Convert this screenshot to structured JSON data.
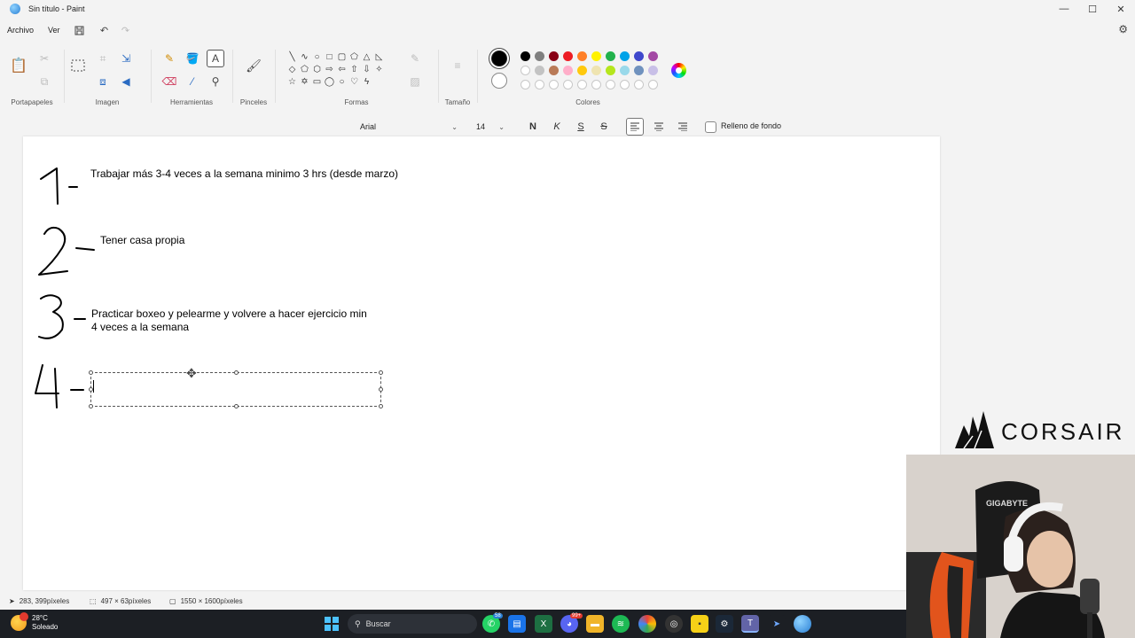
{
  "window": {
    "title": "Sin título - Paint",
    "minimize": "—",
    "maximize": "☐",
    "close": "✕"
  },
  "menu": {
    "file": "Archivo",
    "view": "Ver"
  },
  "ribbon": {
    "groups": {
      "clipboard": "Portapapeles",
      "image": "Imagen",
      "tools": "Herramientas",
      "brushes": "Pinceles",
      "shapes": "Formas",
      "size": "Tamaño",
      "colors": "Colores"
    },
    "primary_color": "#000000",
    "secondary_color": "#ffffff",
    "palette_row1": [
      "#000000",
      "#7f7f7f",
      "#880015",
      "#ed1c24",
      "#ff7f27",
      "#fff200",
      "#22b14c",
      "#00a2e8",
      "#3f48cc",
      "#a349a4"
    ],
    "palette_row2": [
      "#ffffff",
      "#c3c3c3",
      "#b97a57",
      "#ffaec9",
      "#ffc90e",
      "#efe4b0",
      "#b5e61d",
      "#99d9ea",
      "#7092be",
      "#c8bfe7"
    ]
  },
  "textbar": {
    "font": "Arial",
    "size": "14",
    "bold": "N",
    "italic": "K",
    "underline": "S",
    "strike": "S",
    "fill_label": "Relleno de fondo"
  },
  "canvas": {
    "items": [
      "Trabajar más 3-4 veces a la semana minimo 3 hrs (desde marzo)",
      "Tener casa propia",
      "Practicar boxeo y pelearme y volvere a hacer ejercicio min",
      "4 veces a la semana"
    ]
  },
  "status": {
    "cursor": "283, 399píxeles",
    "selection": "497 × 63píxeles",
    "canvas_size": "1550 × 1600píxeles"
  },
  "overlay": {
    "brand": "CORSAIR"
  },
  "taskbar": {
    "weather_temp": "28°C",
    "weather_desc": "Soleado",
    "search": "Buscar",
    "badge_whatsapp": "58",
    "badge_discord": "99+"
  }
}
